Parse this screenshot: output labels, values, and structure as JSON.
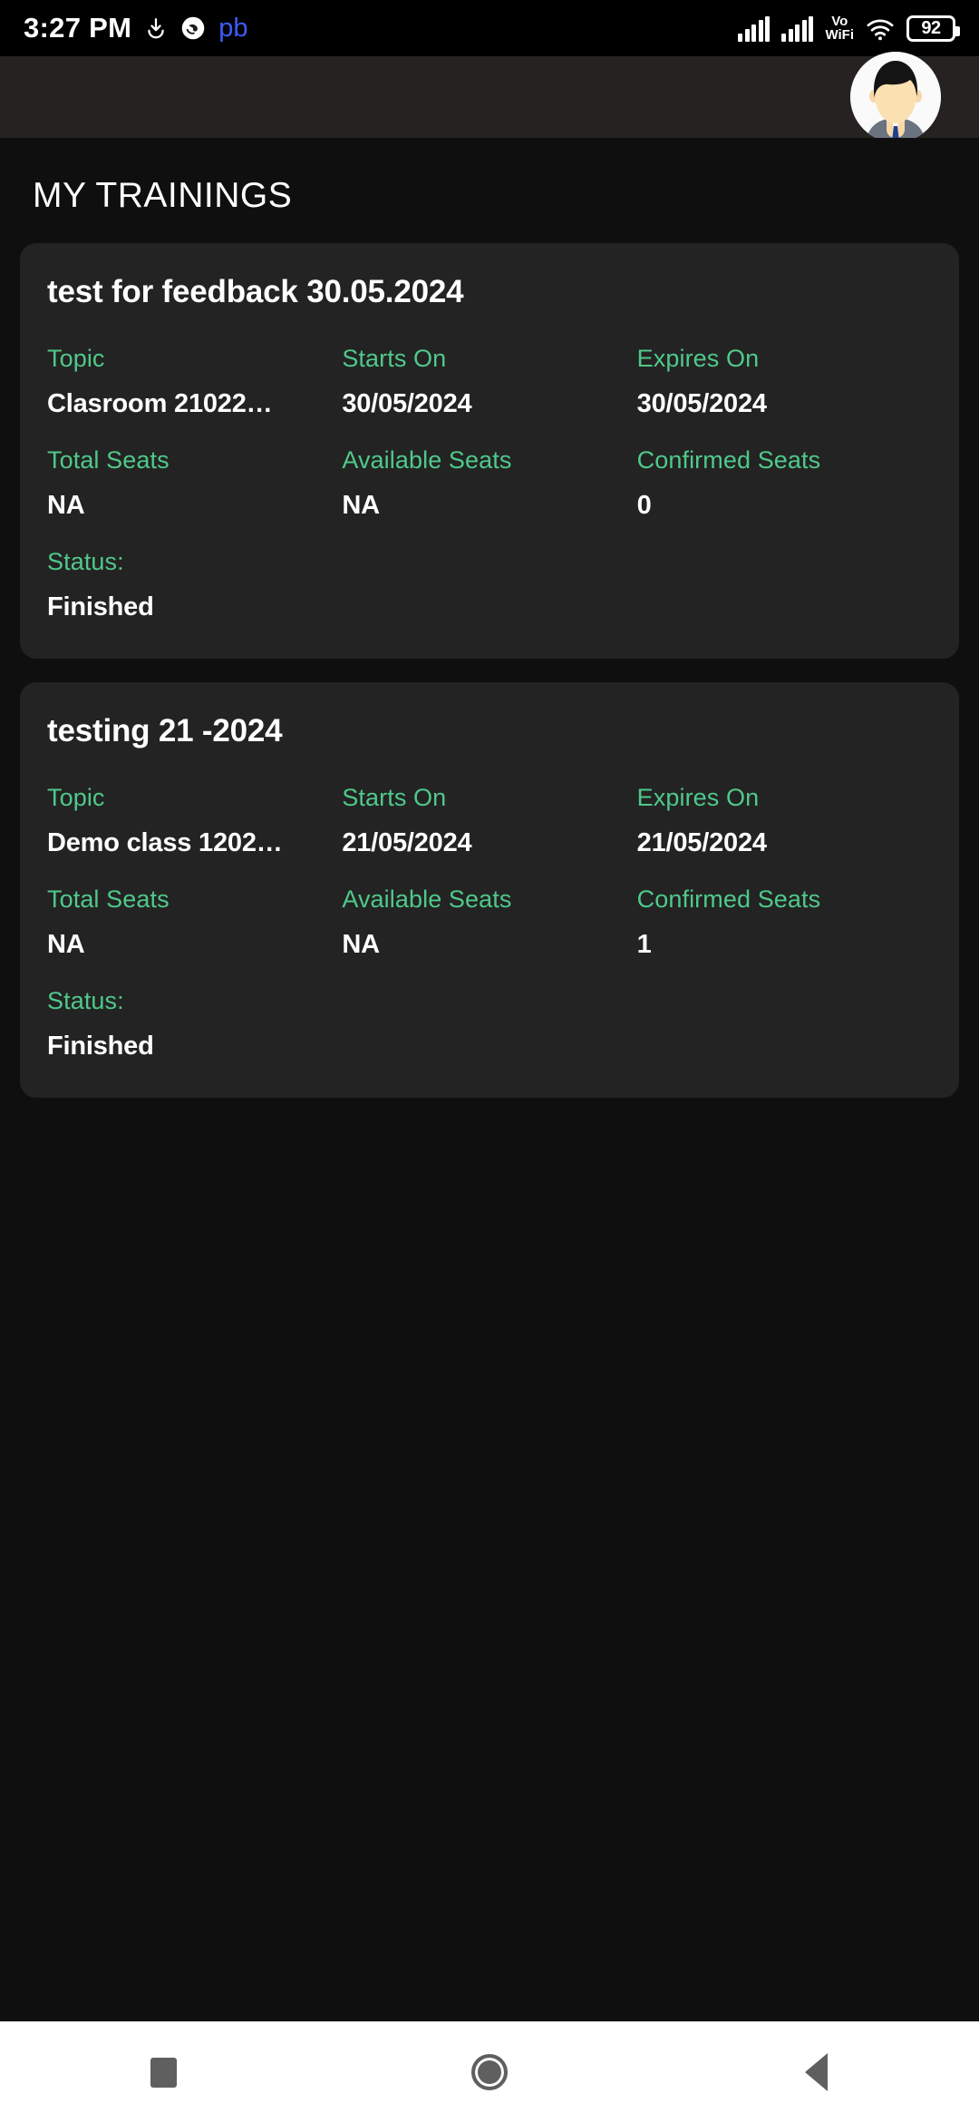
{
  "status_bar": {
    "time": "3:27 PM",
    "download_icon": "download-icon",
    "app_icon": "app-notification-icon",
    "app_label": "pb",
    "signal_1": "signal-bars-icon",
    "signal_2": "signal-bars-icon",
    "vowifi_line1": "Vo",
    "vowifi_line2": "WiFi",
    "wifi_icon": "wifi-icon",
    "battery_level": "92"
  },
  "app_bar": {
    "avatar": "user-avatar"
  },
  "page": {
    "title": "MY TRAININGS"
  },
  "labels": {
    "topic": "Topic",
    "starts_on": "Starts On",
    "expires_on": "Expires On",
    "total_seats": "Total Seats",
    "available_seats": "Available Seats",
    "confirmed_seats": "Confirmed Seats",
    "status": "Status:"
  },
  "colors": {
    "accent_green": "#4fc98a",
    "card_bg": "#232323",
    "page_bg": "#0f0f0f",
    "appbar_bg": "#262222",
    "pb_blue": "#3b5bfd"
  },
  "trainings": [
    {
      "title": "test for feedback 30.05.2024",
      "topic": "Clasroom 21022…",
      "starts_on": "30/05/2024",
      "expires_on": "30/05/2024",
      "total_seats": "NA",
      "available_seats": "NA",
      "confirmed_seats": "0",
      "status": "Finished"
    },
    {
      "title": "testing 21 -2024",
      "topic": "Demo class 1202…",
      "starts_on": "21/05/2024",
      "expires_on": "21/05/2024",
      "total_seats": "NA",
      "available_seats": "NA",
      "confirmed_seats": "1",
      "status": "Finished"
    }
  ],
  "nav_bar": {
    "recents": "recents-square-icon",
    "home": "home-circle-icon",
    "back": "back-triangle-icon"
  }
}
